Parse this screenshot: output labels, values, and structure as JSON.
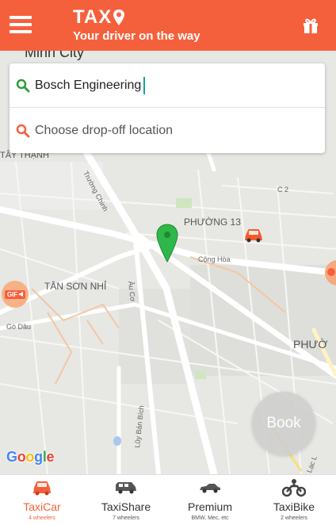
{
  "header": {
    "brand_name": "TAX",
    "tagline": "Your driver on the way"
  },
  "search": {
    "pickup_value": "Bosch Engineering",
    "dropoff_placeholder": "Choose drop-off location"
  },
  "map": {
    "labels": {
      "city": "Minh City",
      "tay_thanh": "TÂY THẠNH",
      "truong_chinh": "Trường Chinh",
      "c2": "C 2",
      "phuong13": "PHƯỜNG 13",
      "cong_hoa": "Cộng Hòa",
      "tan_son_nhi": "TÂN SƠN NHỈ",
      "go_dau": "Gò Dầu",
      "au_co": "Âu Cơ",
      "phuong_right": "PHƯỜ",
      "luy_ban_bich": "Lũy Bán Bích",
      "lac": "Lạc L",
      "gif": "GIF"
    },
    "attribution": "Google"
  },
  "book_label": "Book",
  "tabs": [
    {
      "label": "TaxiCar",
      "sub": "4 wheelers",
      "active": true
    },
    {
      "label": "TaxiShare",
      "sub": "7 wheelers",
      "active": false
    },
    {
      "label": "Premium",
      "sub": "BMW, Mec, etc",
      "active": false
    },
    {
      "label": "TaxiBike",
      "sub": "2 wheelers",
      "active": false
    }
  ],
  "colors": {
    "brand": "#f5603c",
    "pin": "#2fb84a",
    "search_pickup_icon": "#2e9b3a",
    "search_dropoff_icon": "#f5603c"
  }
}
